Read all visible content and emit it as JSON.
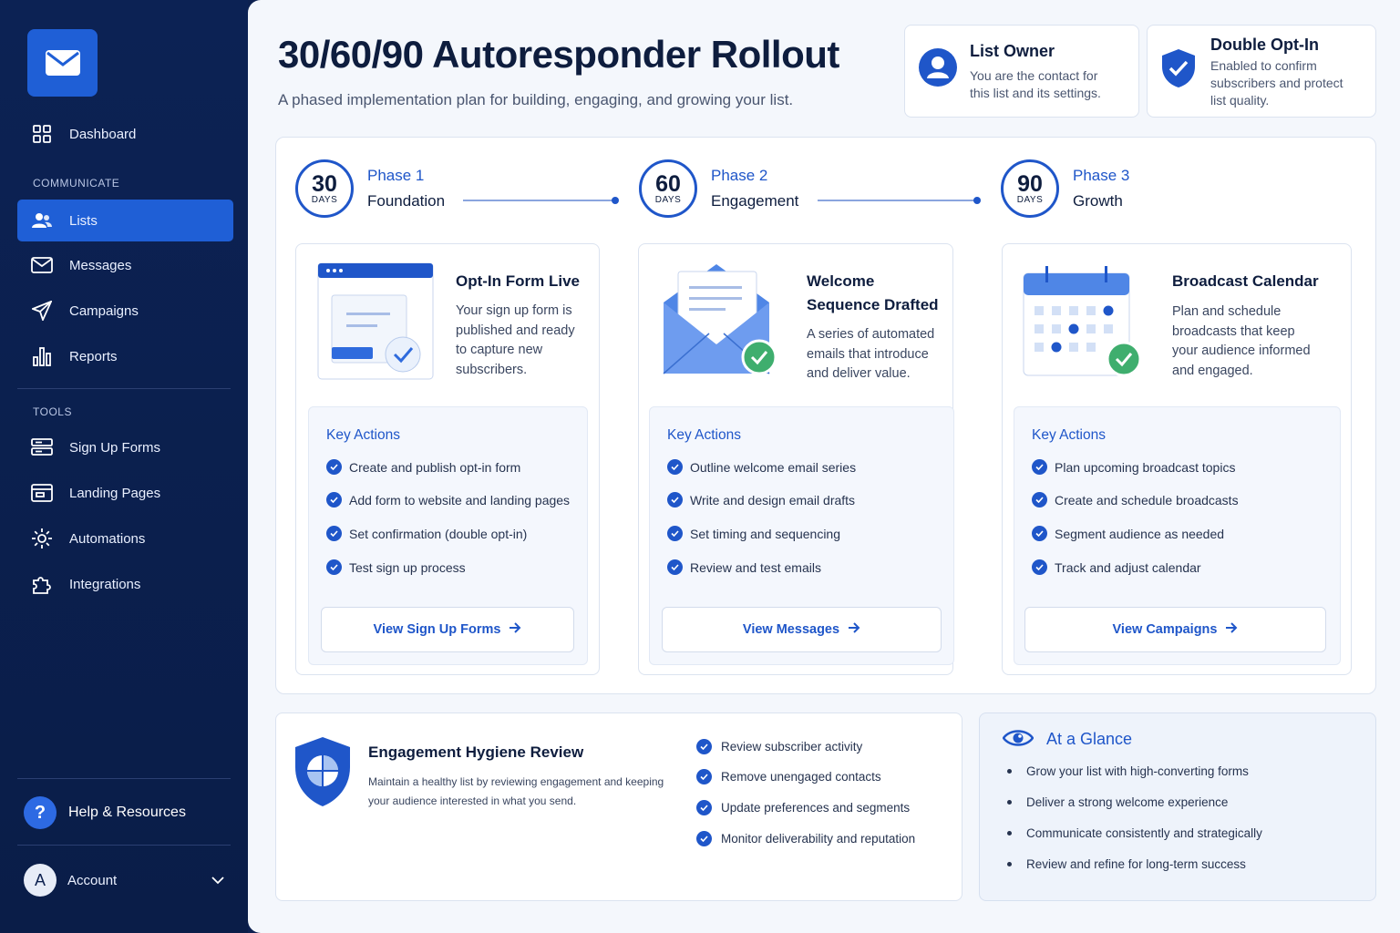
{
  "sidebar": {
    "items": {
      "dashboard": "Dashboard",
      "lists": "Lists",
      "messages": "Messages",
      "campaigns": "Campaigns",
      "reports": "Reports",
      "signup_forms": "Sign Up Forms",
      "landing_pages": "Landing Pages",
      "automations": "Automations",
      "integrations": "Integrations"
    },
    "section_communicate": "COMMUNICATE",
    "section_tools": "TOOLS",
    "help": "Help & Resources",
    "help_glyph": "?",
    "account": "Account",
    "account_initial": "A",
    "active_item": "Lists"
  },
  "header": {
    "title": "30/60/90 Autoresponder Rollout",
    "subtitle": "A phased implementation plan for building, engaging, and growing your list."
  },
  "info_cards": {
    "owner": {
      "title": "List Owner",
      "text": "You are the contact for this list and its settings."
    },
    "optin": {
      "title": "Double Opt-In",
      "text": "Enabled to confirm subscribers and protect list quality."
    }
  },
  "phases": [
    {
      "days": "30",
      "days_label": "DAYS",
      "phase": "Phase 1",
      "name": "Foundation",
      "card_title": "Opt-In Form Live",
      "card_desc": "Your sign up form is published and ready to capture new subscribers.",
      "actions_head": "Key Actions",
      "actions": [
        "Create and publish opt-in form",
        "Add form to website and landing pages",
        "Set confirmation (double opt-in)",
        "Test sign up process"
      ],
      "button": "View Sign Up Forms"
    },
    {
      "days": "60",
      "days_label": "DAYS",
      "phase": "Phase 2",
      "name": "Engagement",
      "card_title": "Welcome Sequence Drafted",
      "card_desc": "A series of automated emails that introduce and deliver value.",
      "actions_head": "Key Actions",
      "actions": [
        "Outline welcome email series",
        "Write and design email drafts",
        "Set timing and sequencing",
        "Review and test emails"
      ],
      "button": "View Messages"
    },
    {
      "days": "90",
      "days_label": "DAYS",
      "phase": "Phase 3",
      "name": "Growth",
      "card_title": "Broadcast Calendar",
      "card_desc": "Plan and schedule broadcasts that keep your audience informed and engaged.",
      "actions_head": "Key Actions",
      "actions": [
        "Plan upcoming broadcast topics",
        "Create and schedule broadcasts",
        "Segment audience as needed",
        "Track and adjust calendar"
      ],
      "button": "View Campaigns"
    }
  ],
  "hygiene": {
    "title": "Engagement Hygiene Review",
    "text": "Maintain a healthy list by reviewing engagement and keeping your audience interested in what you send.",
    "items": [
      "Review subscriber activity",
      "Remove unengaged contacts",
      "Update preferences and segments",
      "Monitor deliverability and reputation"
    ]
  },
  "glance": {
    "title": "At a Glance",
    "items": [
      "Grow your list with high-converting forms",
      "Deliver a strong welcome experience",
      "Communicate consistently and strategically",
      "Review and refine for long-term success"
    ]
  },
  "colors": {
    "accent": "#1f56c9",
    "sidebar": "#0c2254",
    "success": "#3fae6e"
  }
}
